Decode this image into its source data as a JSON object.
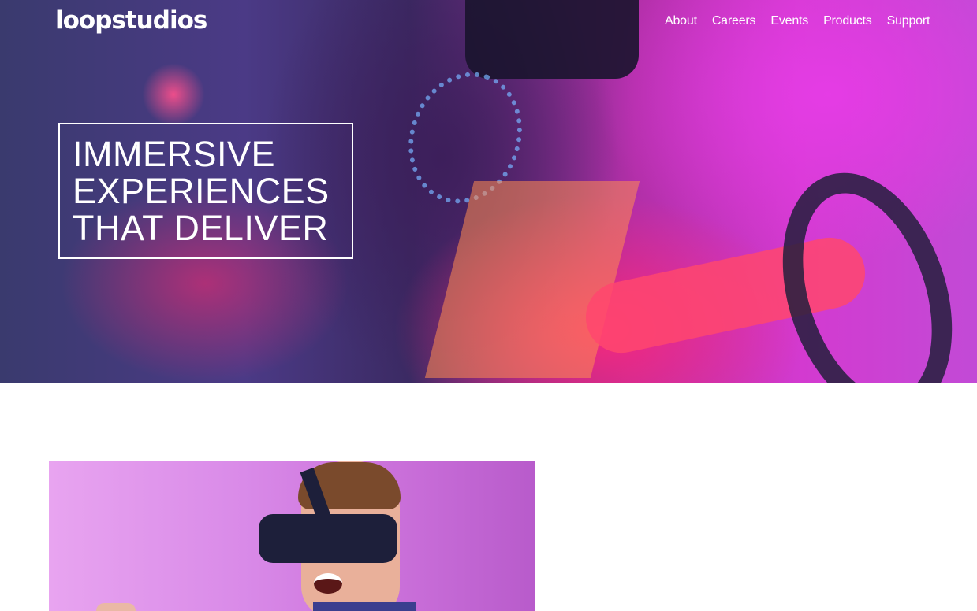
{
  "brand": {
    "name": "loopstudios"
  },
  "nav": {
    "items": [
      {
        "label": "About"
      },
      {
        "label": "Careers"
      },
      {
        "label": "Events"
      },
      {
        "label": "Products"
      },
      {
        "label": "Support"
      }
    ]
  },
  "hero": {
    "headline": [
      "IMMERSIVE",
      "EXPERIENCES",
      "THAT DELIVER"
    ]
  },
  "colors": {
    "text_on_hero": "#ffffff",
    "page_background": "#ffffff",
    "hero_accent_pink": "#ff3a78",
    "hero_accent_magenta": "#d33ad0"
  },
  "icons": []
}
